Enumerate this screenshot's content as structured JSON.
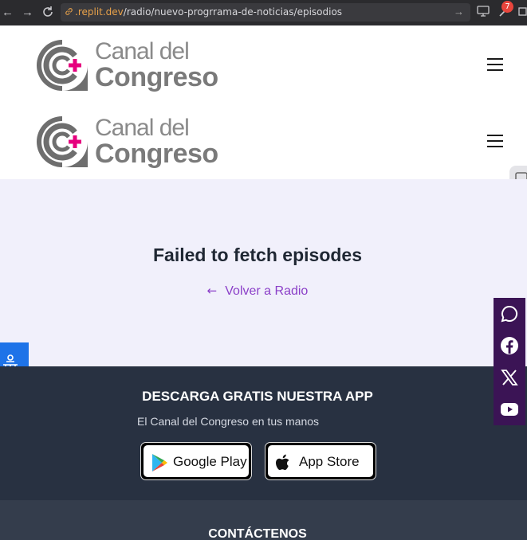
{
  "browser": {
    "url_host": ".replit.dev",
    "url_path": "/radio/nuevo-progrrama-de-noticias/episodios",
    "notification_count": "7"
  },
  "header": {
    "logo_line1": "Canal del",
    "logo_line2": "Congreso"
  },
  "main": {
    "error_message": "Failed to fetch episodes",
    "back_link": "Volver a Radio",
    "back_arrow": "←"
  },
  "footer": {
    "app_title": "DESCARGA GRATIS NUESTRA APP",
    "app_subtitle": "El Canal del Congreso en tus manos",
    "google_play_label": "Google Play",
    "app_store_label": "App Store",
    "contact_title": "CONTÁCTENOS"
  },
  "social": [
    "whatsapp-icon",
    "facebook-icon",
    "x-icon",
    "youtube-icon"
  ],
  "colors": {
    "accent_purple": "#8b3fc8",
    "logo_magenta": "#e6007e",
    "footer_bg": "#283141",
    "social_bg": "#3b1455",
    "a11y_blue": "#1e73e8"
  }
}
